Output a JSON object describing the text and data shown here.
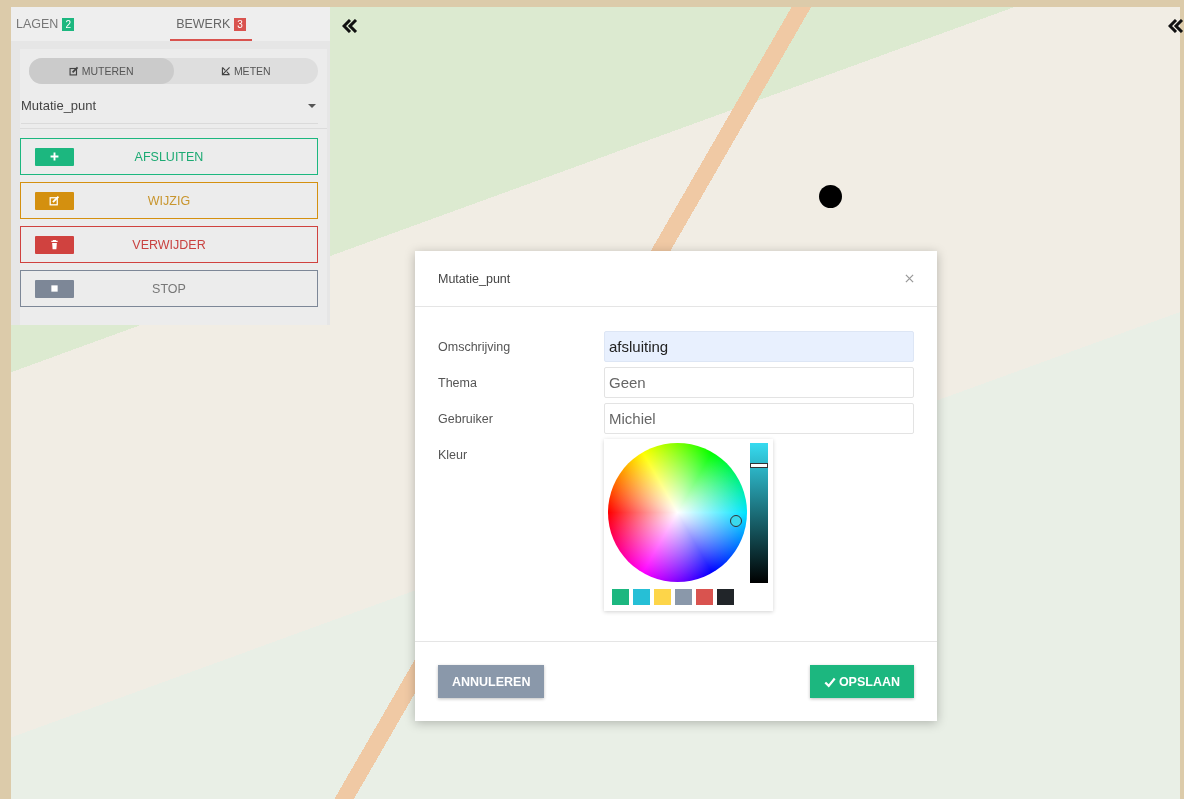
{
  "tabs": [
    {
      "label": "LAGEN",
      "badge": "2",
      "color": "#1cb77f",
      "selected": false
    },
    {
      "label": "BEWERK",
      "badge": "3",
      "color": "#d9534f",
      "selected": true
    }
  ],
  "modes": [
    {
      "label": "MUTEREN",
      "kind": "edit",
      "selected": true
    },
    {
      "label": "METEN",
      "kind": "measure",
      "selected": false
    }
  ],
  "layer_select": {
    "value": "Mutatie_punt"
  },
  "actions": [
    {
      "label": "AFSLUITEN",
      "kind": "add"
    },
    {
      "label": "WIJZIG",
      "kind": "edit"
    },
    {
      "label": "VERWIJDER",
      "kind": "delete"
    },
    {
      "label": "STOP",
      "kind": "stop"
    }
  ],
  "dialog": {
    "title": "Mutatie_punt",
    "fields": [
      {
        "label": "Omschrijving",
        "value": "afsluiting",
        "kind": "text",
        "autofilled": true
      },
      {
        "label": "Thema",
        "value": "Geen",
        "kind": "text",
        "autofilled": false
      },
      {
        "label": "Gebruiker",
        "value": "Michiel",
        "kind": "text",
        "autofilled": false
      },
      {
        "label": "Kleur",
        "kind": "color"
      }
    ],
    "brightness": {
      "level": 0.84
    },
    "swatches": [
      {
        "color": "#1cb77f"
      },
      {
        "color": "#26bfd6"
      },
      {
        "color": "#fdd549"
      },
      {
        "color": "#8a98aa"
      },
      {
        "color": "#d9534f"
      },
      {
        "color": "#212529"
      }
    ],
    "buttons": [
      {
        "label": "ANNULEREN",
        "kind": "cancel"
      },
      {
        "label": "OPSLAAN",
        "kind": "save"
      }
    ]
  }
}
